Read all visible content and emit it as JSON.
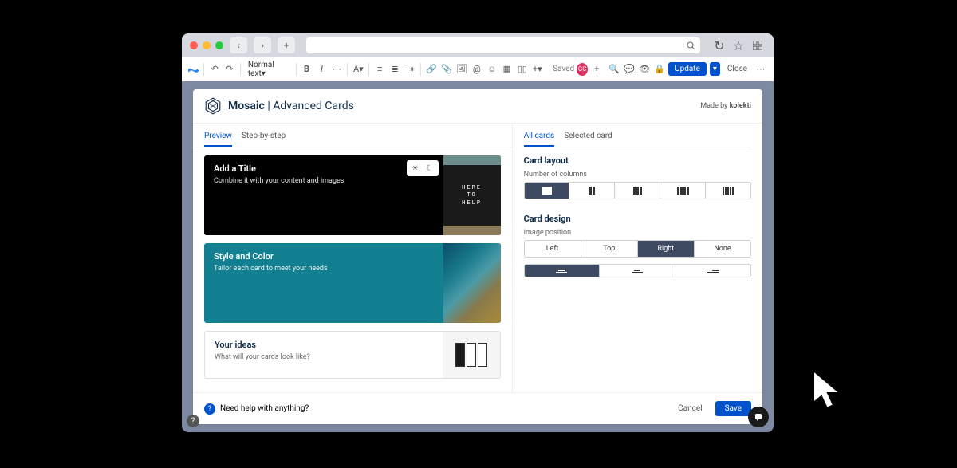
{
  "toolbar": {
    "text_style": "Normal text",
    "saved": "Saved",
    "avatar_initials": "GC",
    "update": "Update",
    "close": "Close"
  },
  "panel": {
    "brand": "Mosaic",
    "title": "Advanced Cards",
    "made_by_prefix": "Made by ",
    "made_by": "kolekti"
  },
  "left_tabs": {
    "preview": "Preview",
    "step": "Step-by-step"
  },
  "cards": [
    {
      "title": "Add a Title",
      "sub": "Combine it with your content and images",
      "img_text": "HERE\nTO\nHELP"
    },
    {
      "title": "Style and Color",
      "sub": "Tailor each card to meet your needs"
    },
    {
      "title": "Your ideas",
      "sub": "What will your cards look like?"
    }
  ],
  "right_tabs": {
    "all": "All cards",
    "selected": "Selected card"
  },
  "layout": {
    "section": "Card layout",
    "columns_label": "Number of columns"
  },
  "design": {
    "section": "Card design",
    "image_pos_label": "Image position",
    "positions": {
      "left": "Left",
      "top": "Top",
      "right": "Right",
      "none": "None"
    }
  },
  "footer": {
    "help_text": "Need help with anything?",
    "cancel": "Cancel",
    "save": "Save"
  }
}
